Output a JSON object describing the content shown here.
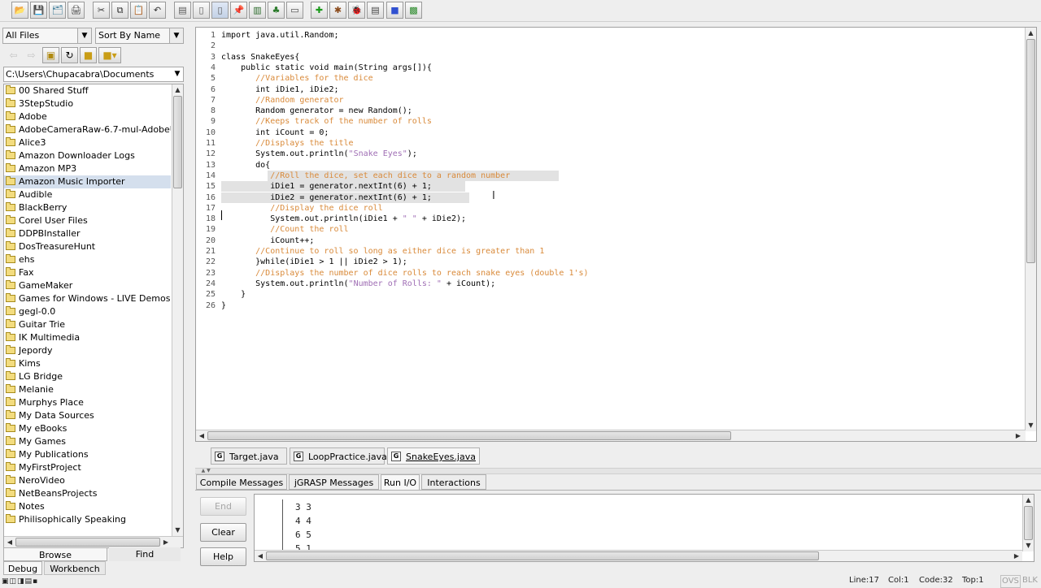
{
  "toolbar": {
    "icons": [
      "open-folder-icon",
      "save-icon",
      "save-all-icon",
      "print-icon",
      "cut-icon",
      "copy-icon",
      "paste-icon",
      "undo-icon",
      "generate-csd-icon",
      "remove-csd-icon",
      "fold-icon",
      "pin-icon",
      "build-icon",
      "compile-icon",
      "jar-icon",
      "run-icon",
      "debug-icon",
      "bug-icon",
      "step-icon",
      "stop-icon",
      "canvas-icon"
    ]
  },
  "browse": {
    "filter_value": "All Files",
    "sort_value": "Sort By Name",
    "path_value": "C:\\Users\\Chupacabra\\Documents",
    "folders": [
      "00 Shared Stuff",
      "3StepStudio",
      "Adobe",
      "AdobeCameraRaw-6.7-mul-AdobeUpdate",
      "Alice3",
      "Amazon Downloader Logs",
      "Amazon MP3",
      "Amazon Music Importer",
      "Audible",
      "BlackBerry",
      "Corel User Files",
      "DDPBInstaller",
      "DosTreasureHunt",
      "ehs",
      "Fax",
      "GameMaker",
      "Games for Windows - LIVE Demos",
      "gegl-0.0",
      "Guitar Trie",
      "IK Multimedia",
      "Jepordy",
      "Kims",
      "LG Bridge",
      "Melanie",
      "Murphys Place",
      "My Data Sources",
      "My eBooks",
      "My Games",
      "My Publications",
      "MyFirstProject",
      "NeroVideo",
      "NetBeansProjects",
      "Notes",
      "Philisophically Speaking"
    ],
    "selected_folder": "Amazon Music Importer",
    "tab_browse": "Browse",
    "tab_find": "Find",
    "tab_debug": "Debug",
    "tab_workbench": "Workbench"
  },
  "editor": {
    "lines": [
      [
        [
          "import java.util.Random;",
          ""
        ]
      ],
      [],
      [
        [
          "class SnakeEyes{",
          ""
        ]
      ],
      [
        [
          "    public static void main(String args[]){",
          ""
        ]
      ],
      [
        [
          "       //Variables for the dice",
          "cm"
        ]
      ],
      [
        [
          "       int iDie1, iDie2;",
          ""
        ]
      ],
      [
        [
          "       //Random generator",
          "cm"
        ]
      ],
      [
        [
          "       Random generator = new Random();",
          ""
        ]
      ],
      [
        [
          "       //Keeps track of the number of rolls",
          "cm"
        ]
      ],
      [
        [
          "       int iCount = 0;",
          ""
        ]
      ],
      [
        [
          "       //Displays the title",
          "cm"
        ]
      ],
      [
        [
          "       System.out.println(",
          ""
        ],
        [
          "\"Snake Eyes\"",
          "st"
        ],
        [
          ");",
          ""
        ]
      ],
      [
        [
          "       do{",
          ""
        ]
      ],
      [
        [
          "          //Roll the dice, set each dice to a random number",
          "cm"
        ]
      ],
      [
        [
          "          iDie1 = generator.nextInt(6) + 1;",
          ""
        ]
      ],
      [
        [
          "          iDie2 = generator.nextInt(6) + 1;",
          ""
        ]
      ],
      [
        [
          "          //Display the dice roll",
          "cm"
        ]
      ],
      [
        [
          "          System.out.println(iDie1 + ",
          ""
        ],
        [
          "\" \"",
          "st"
        ],
        [
          " + iDie2);",
          ""
        ]
      ],
      [
        [
          "          //Count the roll",
          "cm"
        ]
      ],
      [
        [
          "          iCount++;",
          ""
        ]
      ],
      [
        [
          "       //Continue to roll so long as either dice is greater than 1",
          "cm"
        ]
      ],
      [
        [
          "       }while(iDie1 > 1 || iDie2 > 1);",
          ""
        ]
      ],
      [
        [
          "       //Displays the number of dice rolls to reach snake eyes (double 1's)",
          "cm"
        ]
      ],
      [
        [
          "       System.out.println(",
          ""
        ],
        [
          "\"Number of Rolls: \"",
          "st"
        ],
        [
          " + iCount);",
          ""
        ]
      ],
      [
        [
          "    }",
          ""
        ]
      ],
      [
        [
          "}",
          ""
        ]
      ]
    ]
  },
  "file_tabs": [
    "Target.java",
    "LoopPractice.java",
    "SnakeEyes.java"
  ],
  "active_file_tab": "SnakeEyes.java",
  "message_tabs": [
    "Compile Messages",
    "jGRASP Messages",
    "Run I/O",
    "Interactions"
  ],
  "active_message_tab": "Run I/O",
  "run_io": {
    "end_label": "End",
    "clear_label": "Clear",
    "help_label": "Help",
    "output_lines": [
      "3 3",
      "4 4",
      "6 5",
      "5 1"
    ]
  },
  "status": {
    "line": "Line:17",
    "col": "Col:1",
    "code": "Code:32",
    "top": "Top:1",
    "ovs": "OVS",
    "blk": "BLK"
  }
}
